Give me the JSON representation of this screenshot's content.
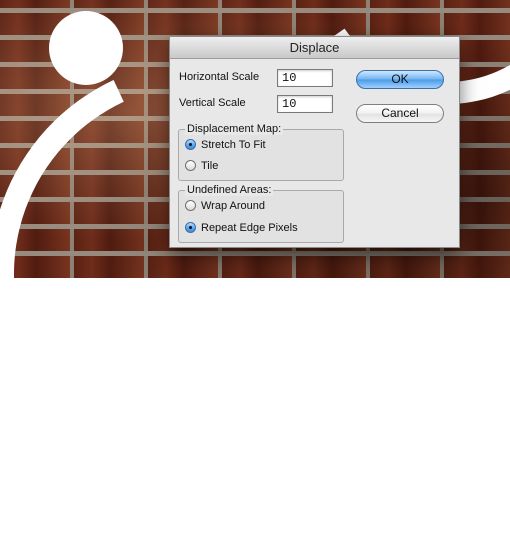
{
  "dialog": {
    "title": "Displace",
    "horizontal_scale": {
      "label": "Horizontal Scale",
      "value": "10"
    },
    "vertical_scale": {
      "label": "Vertical Scale",
      "value": "10"
    },
    "ok_label": "OK",
    "cancel_label": "Cancel",
    "displacement_map": {
      "title": "Displacement Map:",
      "options": [
        {
          "label": "Stretch To Fit",
          "selected": true
        },
        {
          "label": "Tile",
          "selected": false
        }
      ]
    },
    "undefined_areas": {
      "title": "Undefined Areas:",
      "options": [
        {
          "label": "Wrap Around",
          "selected": false
        },
        {
          "label": "Repeat Edge Pixels",
          "selected": true
        }
      ]
    }
  },
  "colors": {
    "dialog_bg": "#e8e8e8",
    "accent_button": "#6fb3f3"
  }
}
